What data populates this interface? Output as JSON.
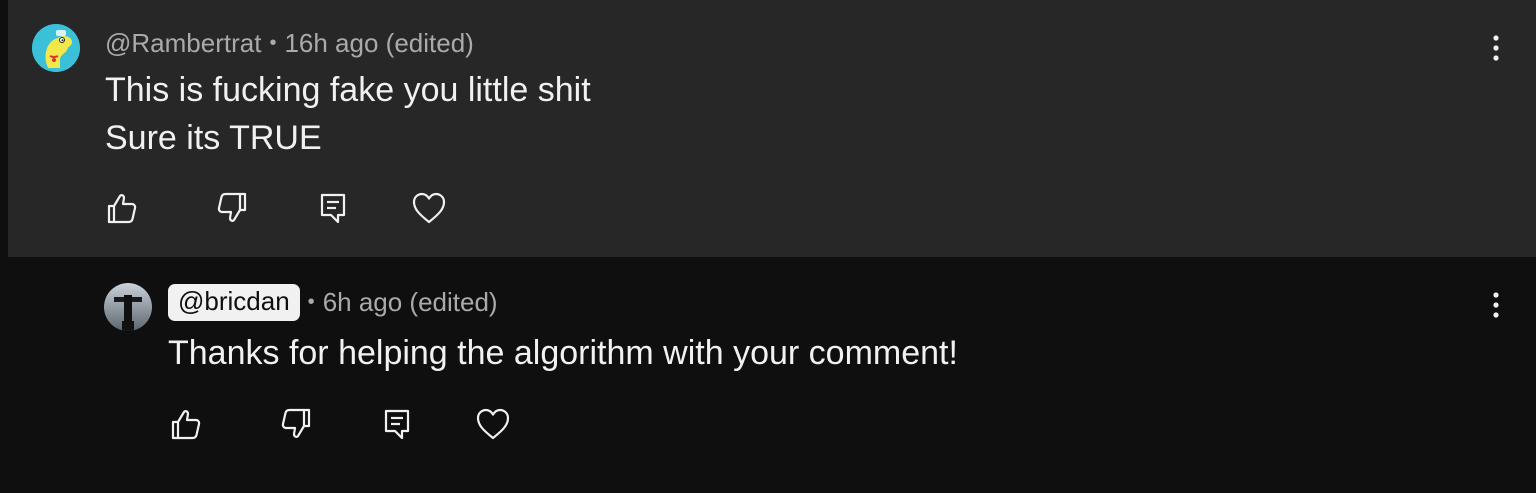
{
  "comments": [
    {
      "author": "@Rambertrat",
      "time": "16h ago (edited)",
      "lines": [
        "This is fucking fake you little shit",
        "Sure its TRUE"
      ],
      "avatar_icon": "cartoon-dog-avatar",
      "actions": [
        "like-icon",
        "dislike-icon",
        "reply-icon",
        "heart-icon"
      ]
    }
  ],
  "reply": {
    "author": "@bricdan",
    "time": "6h ago (edited)",
    "text": "Thanks for helping the algorithm with your comment!",
    "avatar_icon": "figure-avatar",
    "actions": [
      "like-icon",
      "dislike-icon",
      "reply-icon",
      "heart-icon"
    ]
  },
  "separator": "•",
  "colors": {
    "top_comment_bg": "#272727",
    "reply_bg": "#0f0f0f",
    "text": "#f1f1f1",
    "meta": "#aaaaaa"
  }
}
